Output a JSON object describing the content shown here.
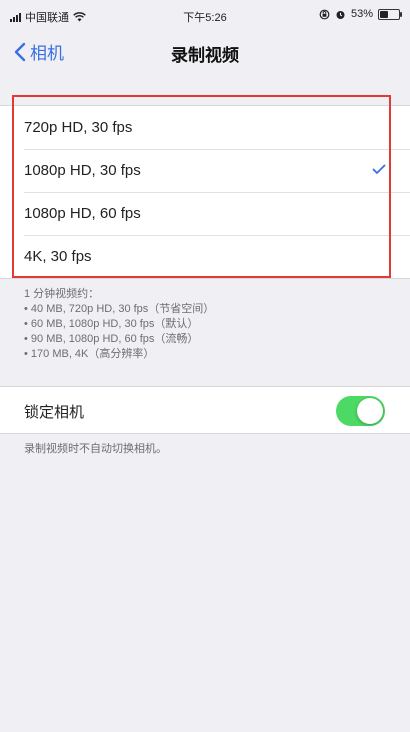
{
  "status_bar": {
    "carrier": "中国联通",
    "time": "下午5:26",
    "battery_percent": "53%",
    "battery_level": 0.53
  },
  "nav": {
    "back_label": "相机",
    "title": "录制视频"
  },
  "options": [
    {
      "label": "720p HD, 30 fps",
      "selected": false
    },
    {
      "label": "1080p HD, 30 fps",
      "selected": true
    },
    {
      "label": "1080p HD, 60 fps",
      "selected": false
    },
    {
      "label": "4K, 30 fps",
      "selected": false
    }
  ],
  "notes": [
    "1 分钟视频约：",
    "• 40 MB, 720p HD, 30 fps（节省空间）",
    "• 60 MB, 1080p HD, 30 fps（默认）",
    "• 90 MB, 1080p HD, 60 fps（流畅）",
    "• 170 MB, 4K（高分辨率）"
  ],
  "lock_camera": {
    "label": "锁定相机",
    "enabled": true,
    "note": "录制视频时不自动切换相机。"
  },
  "colors": {
    "accent": "#3a6fe0",
    "toggle_on": "#4cd964",
    "highlight": "#e53935"
  }
}
